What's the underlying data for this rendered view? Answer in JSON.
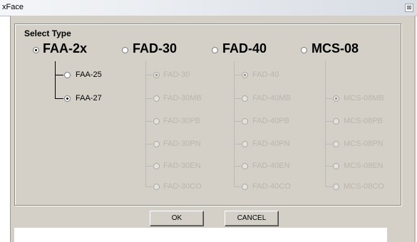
{
  "window": {
    "title": "xFace",
    "close_glyph": "⊠"
  },
  "group": {
    "label": "Select Type"
  },
  "types": [
    {
      "label": "FAA-2x",
      "selected": true
    },
    {
      "label": "FAD-30",
      "selected": false
    },
    {
      "label": "FAD-40",
      "selected": false
    },
    {
      "label": "MCS-08",
      "selected": false
    }
  ],
  "faa": {
    "options": [
      "FAA-25",
      "FAA-27"
    ],
    "selected": "FAA-27"
  },
  "fad30": {
    "options": [
      "FAD-30",
      "FAD-30MB",
      "FAD-30PB",
      "FAD-30PN",
      "FAD-30EN",
      "FAD-30CO"
    ],
    "selected": "FAD-30"
  },
  "fad40": {
    "options": [
      "FAD-40",
      "FAD-40MB",
      "FAD-40PB",
      "FAD-40PN",
      "FAD-40EN",
      "FAD-40CO"
    ],
    "selected": "FAD-40"
  },
  "mcs08": {
    "options": [
      "MCS-08MB",
      "MCS-08PB",
      "MCS-08PN",
      "MCS-08EN",
      "MCS-08CO"
    ],
    "selected": "MCS-08MB"
  },
  "buttons": {
    "ok": "OK",
    "cancel": "CANCEL"
  },
  "colors": {
    "dialog_bg": "#d4d0c8",
    "disabled_text": "#b8b6b0"
  }
}
